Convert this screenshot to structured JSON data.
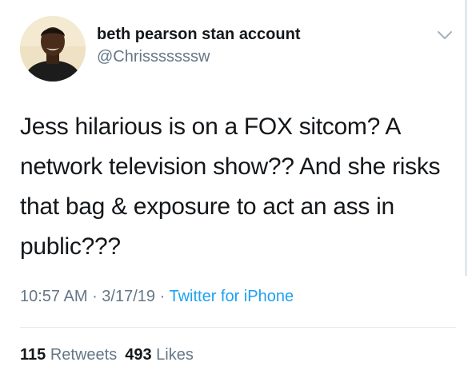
{
  "author": {
    "display_name": "beth pearson stan account",
    "handle": "@Chrisssssssw"
  },
  "tweet": {
    "text": "Jess hilarious is on a FOX sitcom? A network television show?? And she risks that bag & exposure to act an ass in public???"
  },
  "meta": {
    "time": "10:57 AM",
    "sep1": " · ",
    "date": "3/17/19",
    "sep2": " · ",
    "source": "Twitter for iPhone"
  },
  "stats": {
    "retweets_count": "115",
    "retweets_label": " Retweets",
    "likes_count": "493",
    "likes_label": " Likes"
  },
  "icons": {
    "caret": "chevron-down-icon"
  },
  "colors": {
    "text": "#14171a",
    "secondary": "#657786",
    "link": "#1da1f2",
    "divider": "#e1e8ed"
  }
}
